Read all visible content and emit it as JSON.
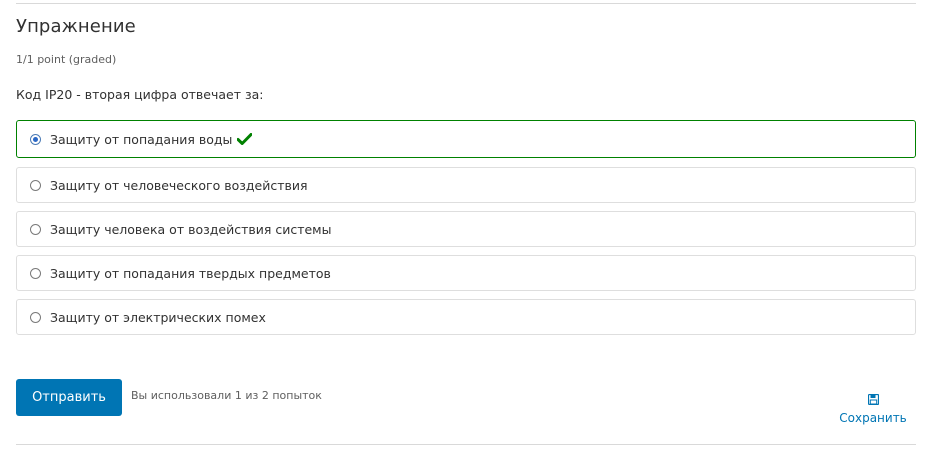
{
  "problem": {
    "title": "Упражнение",
    "progress": "1/1 point (graded)",
    "question": "Код IP20 - вторая цифра отвечает за:",
    "choices": [
      {
        "label": "Защиту от попадания воды",
        "selected": true,
        "status": "correct"
      },
      {
        "label": "Защиту от человеческого воздействия",
        "selected": false
      },
      {
        "label": "Защиту человека от воздействия системы",
        "selected": false
      },
      {
        "label": "Защиту от попадания твердых предметов",
        "selected": false
      },
      {
        "label": "Защиту от электрических помех",
        "selected": false
      }
    ]
  },
  "actions": {
    "submit_label": "Отправить",
    "attempts_text": "Вы использовали 1 из 2 попыток",
    "save_label": "Сохранить",
    "save_icon": "floppy-disk-icon",
    "correct_icon": "checkmark-icon"
  },
  "colors": {
    "accent": "#0075b4",
    "correct": "#008100",
    "border": "#dedede"
  }
}
